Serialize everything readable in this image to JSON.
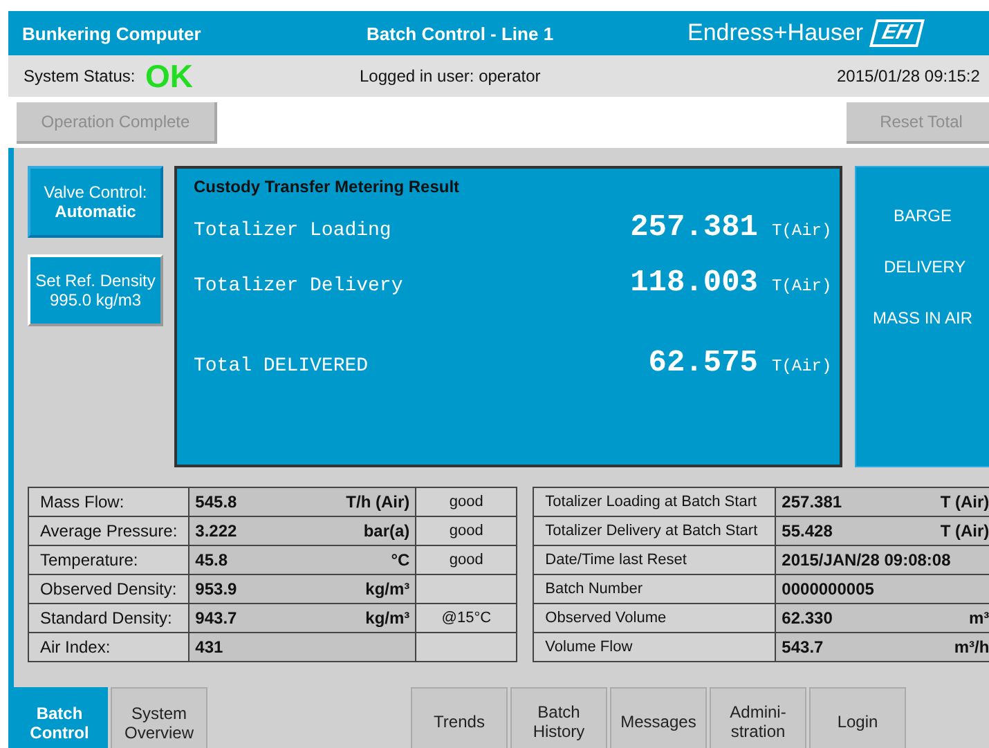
{
  "header": {
    "title": "Bunkering Computer",
    "screen_title": "Batch Control - Line 1",
    "brand": "Endress+Hauser",
    "brand_mark": "EH"
  },
  "status_bar": {
    "label": "System Status:",
    "status": "OK",
    "user": "Logged in user: operator",
    "datetime": "2015/01/28 09:15:2"
  },
  "toolbar": [
    {
      "label": "Operation Complete",
      "disabled": true
    },
    {
      "label": "Reset Total",
      "disabled": true
    }
  ],
  "side_buttons": [
    {
      "label": "Valve Control:",
      "value": "Automatic",
      "selected": false
    },
    {
      "label": "Set Ref. Density",
      "value": "995.0 kg/m3",
      "selected": true
    }
  ],
  "result": {
    "title": "Custody Transfer Metering Result",
    "rows": [
      {
        "kind": "totalizer",
        "label": "Totalizer Loading",
        "value": "257.381",
        "unit": "T(Air)"
      },
      {
        "kind": "totalizer",
        "label": "Totalizer Delivery",
        "value": "118.003",
        "unit": "T(Air)"
      },
      {
        "kind": "sum",
        "label": "Total DELIVERED",
        "value": "62.575",
        "unit": "T(Air)"
      }
    ]
  },
  "mode_panel": [
    "BARGE",
    "DELIVERY",
    "MASS IN AIR"
  ],
  "process_table": [
    {
      "label": "Mass Flow:",
      "value": "545.8",
      "unit": "T/h (Air)",
      "note": "good"
    },
    {
      "label": "Average Pressure:",
      "value": "3.222",
      "unit": "bar(a)",
      "note": "good"
    },
    {
      "label": "Temperature:",
      "value": "45.8",
      "unit": "°C",
      "note": "good"
    },
    {
      "label": "Observed Density:",
      "value": "953.9",
      "unit": "kg/m³"
    },
    {
      "label": "Standard Density:",
      "value": "943.7",
      "unit": "kg/m³",
      "note": "@15°C"
    },
    {
      "label": "Air Index:",
      "value": "431"
    }
  ],
  "batch_table": [
    {
      "label": "Totalizer Loading at Batch Start",
      "value": "257.381",
      "unit": "T (Air)"
    },
    {
      "label": "Totalizer Delivery at Batch Start",
      "value": "55.428",
      "unit": "T (Air)"
    },
    {
      "label": "Date/Time last Reset",
      "value": "2015/JAN/28 09:08:08"
    },
    {
      "label": "Batch Number",
      "value": "0000000005"
    },
    {
      "label": "Observed Volume",
      "value": "62.330",
      "unit": "m³"
    },
    {
      "label": "Volume Flow",
      "value": "543.7",
      "unit": "m³/h"
    }
  ],
  "tabs": [
    {
      "lines": [
        "Batch",
        "Control"
      ],
      "selected": true,
      "kind": "main"
    },
    {
      "lines": [
        "System",
        "Overview"
      ],
      "selected": false,
      "kind": "main"
    },
    {
      "lines": [
        "Trends"
      ],
      "selected": false,
      "kind": "tool"
    },
    {
      "lines": [
        "Batch",
        "History"
      ],
      "selected": false,
      "kind": "tool"
    },
    {
      "lines": [
        "Messages"
      ],
      "selected": false,
      "kind": "tool"
    },
    {
      "lines": [
        "Admini-",
        "stration"
      ],
      "selected": false,
      "kind": "tool"
    },
    {
      "lines": [
        "Login"
      ],
      "selected": false,
      "kind": "tool"
    }
  ]
}
